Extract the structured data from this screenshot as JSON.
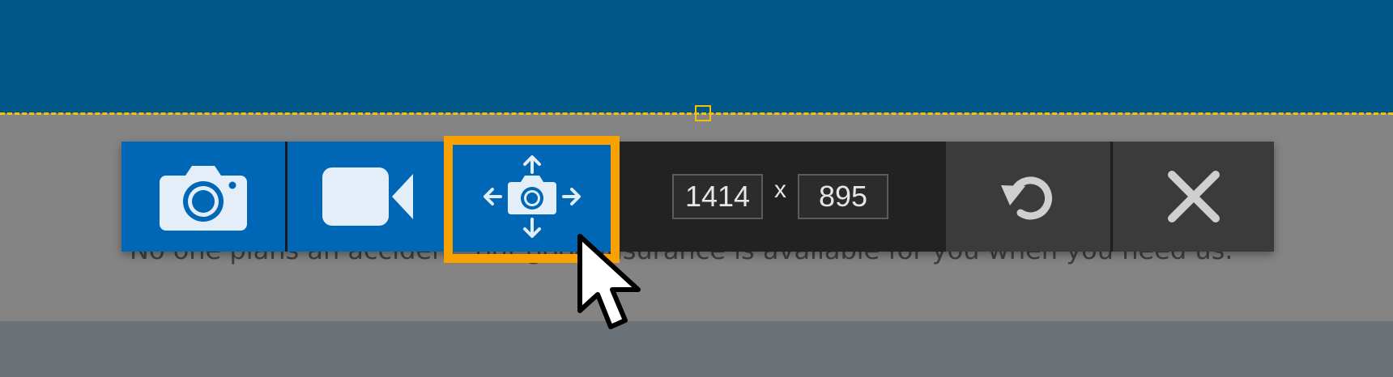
{
  "background": {
    "text": "No one plans an accident, but good insurance is available for you when you need us.",
    "colors": {
      "header": "#005687",
      "overlay": "#848484",
      "footer": "#6b7379",
      "selection": "#f6c200"
    }
  },
  "toolbar": {
    "buttons": [
      {
        "name": "screenshot",
        "icon": "camera-icon"
      },
      {
        "name": "record-video",
        "icon": "video-camera-icon"
      },
      {
        "name": "capture-area",
        "icon": "move-camera-icon",
        "selected": true
      },
      {
        "name": "reset",
        "icon": "rotate-left-icon"
      },
      {
        "name": "close",
        "icon": "close-icon"
      }
    ],
    "width_value": "1414",
    "height_value": "895",
    "times_label": "x",
    "accent": "#0067b7",
    "highlight": "#f9a100"
  }
}
